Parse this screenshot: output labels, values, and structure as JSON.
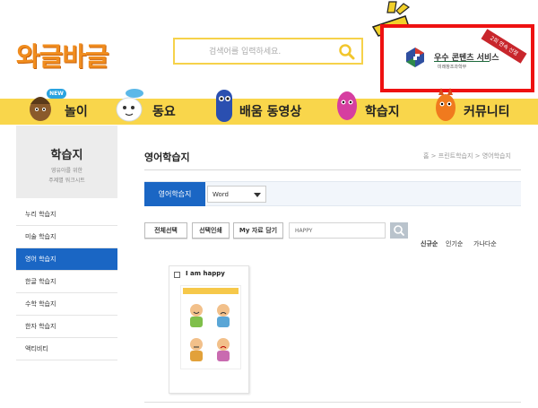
{
  "header": {
    "logo_text": "와글바글",
    "search_placeholder": "검색어를 입력하세요."
  },
  "award": {
    "title": "우수 콘텐츠 서비스",
    "org": "미래창조과학부",
    "ribbon": "2회 연속 선정"
  },
  "nav": {
    "new_badge": "NEW",
    "items": [
      {
        "label": "놀이"
      },
      {
        "label": "동요"
      },
      {
        "label": "배움 동영상"
      },
      {
        "label": "학습지"
      },
      {
        "label": "커뮤니티"
      }
    ]
  },
  "sidebar": {
    "title": "학습지",
    "subtitle_line1": "영유아를 위한",
    "subtitle_line2": "주제별 워크시트",
    "items": [
      {
        "label": "누리 학습지",
        "active": false
      },
      {
        "label": "미술 학습지",
        "active": false
      },
      {
        "label": "영어 학습지",
        "active": true
      },
      {
        "label": "한글 학습지",
        "active": false
      },
      {
        "label": "수학 학습지",
        "active": false
      },
      {
        "label": "한자 학습지",
        "active": false
      },
      {
        "label": "액티비티",
        "active": false
      }
    ]
  },
  "main": {
    "title": "영어학습지",
    "breadcrumb": "홈 > 프린트학습지 > 영어학습지",
    "filter_tab": "영어학습지",
    "filter_select": "Word",
    "buttons": {
      "select_all": "전체선택",
      "print_selected": "선택인쇄",
      "my_data": "My 자료 담기"
    },
    "keyword_value": "HAPPY",
    "sort": {
      "newest": "신규순",
      "popular": "인기순",
      "alphabetical": "가나다순"
    },
    "cards": [
      {
        "title": "I am happy",
        "emotions": [
          "Happy",
          "Sad",
          "Sick",
          "Angry"
        ]
      }
    ]
  },
  "colors": {
    "nav_yellow": "#f9d64b",
    "accent_blue": "#1a66c4",
    "logo_orange": "#f08c1e",
    "highlight_red": "#ee1111"
  }
}
